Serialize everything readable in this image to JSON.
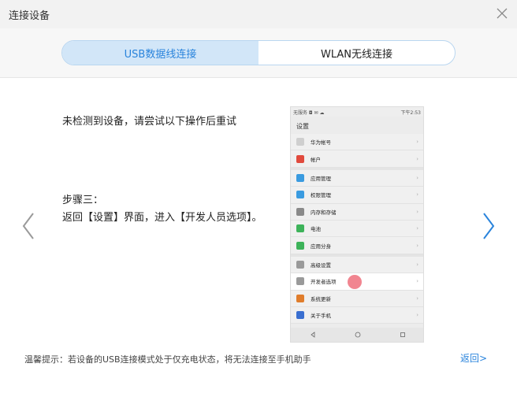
{
  "window": {
    "title": "连接设备"
  },
  "tabs": [
    {
      "label": "USB数据线连接",
      "active": true
    },
    {
      "label": "WLAN无线连接",
      "active": false
    }
  ],
  "main": {
    "message": "未检测到设备，请尝试以下操作后重试",
    "step_title": "步骤三：",
    "step_body": "返回【设置】界面，进入【开发人员选项】。"
  },
  "phone": {
    "status_left": "无服务 ◘ ✉ ☁",
    "status_right": "下午2:53",
    "settings_title": "设置",
    "items": [
      {
        "label": "华为帐号",
        "color": "#cfcfcf"
      },
      {
        "label": "帐户",
        "color": "#e14a3d"
      },
      {
        "label": "应用管理",
        "color": "#3a9be0"
      },
      {
        "label": "权限管理",
        "color": "#3a9be0"
      },
      {
        "label": "内存和存储",
        "color": "#8a8a8a"
      },
      {
        "label": "电池",
        "color": "#3db35a"
      },
      {
        "label": "应用分身",
        "color": "#3db35a"
      },
      {
        "label": "高级设置",
        "color": "#9a9a9a"
      },
      {
        "label": "开发者选项",
        "color": "#9a9a9a"
      },
      {
        "label": "系统更新",
        "color": "#e07d2c"
      },
      {
        "label": "关于手机",
        "color": "#3a6fd0"
      }
    ]
  },
  "footer": {
    "tip": "温馨提示：若设备的USB连接模式处于仅充电状态，将无法连接至手机助手",
    "return_label": "返回>"
  },
  "colors": {
    "accent": "#2a84dc",
    "tab_active_bg": "#d2e6f8"
  }
}
